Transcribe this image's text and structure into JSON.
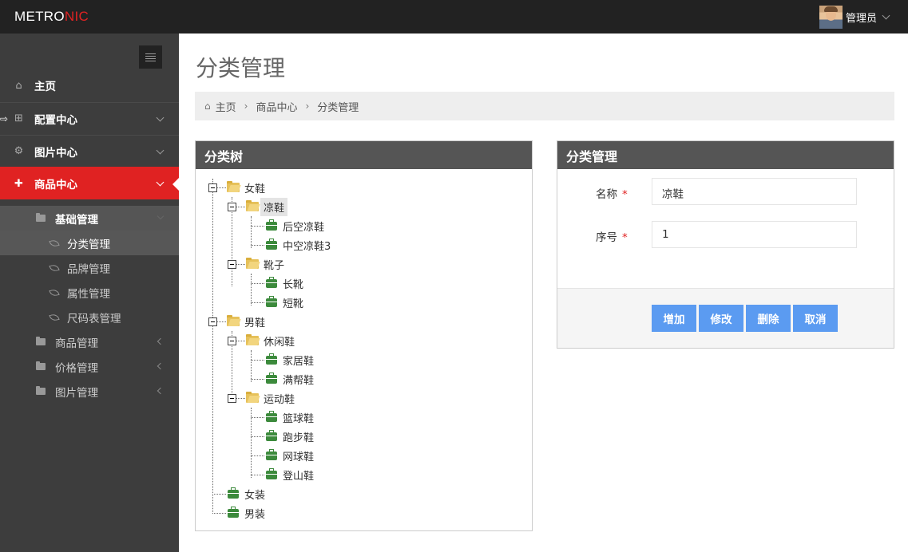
{
  "brand": {
    "prefix": "METRO",
    "accent": "NIC",
    "accent_color": "#e02222"
  },
  "user": {
    "name": "管理员"
  },
  "sidebar": {
    "items": [
      {
        "label": "主页",
        "icon": "home-icon"
      },
      {
        "label": "配置中心",
        "icon": "gift-icon"
      },
      {
        "label": "图片中心",
        "icon": "cogs-icon"
      },
      {
        "label": "商品中心",
        "icon": "puzzle-icon"
      }
    ],
    "submenu": {
      "group_label": "基础管理",
      "children": [
        "分类管理",
        "品牌管理",
        "属性管理",
        "尺码表管理"
      ],
      "others": [
        "商品管理",
        "价格管理",
        "图片管理"
      ]
    }
  },
  "page": {
    "title": "分类管理"
  },
  "breadcrumb": [
    "主页",
    "商品中心",
    "分类管理"
  ],
  "tree_panel": {
    "title": "分类树",
    "nodes": [
      "女鞋",
      "凉鞋",
      "后空凉鞋",
      "中空凉鞋3",
      "靴子",
      "长靴",
      "短靴",
      "男鞋",
      "休闲鞋",
      "家居鞋",
      "满帮鞋",
      "运动鞋",
      "篮球鞋",
      "跑步鞋",
      "网球鞋",
      "登山鞋",
      "女装",
      "男装"
    ],
    "selected": "凉鞋"
  },
  "form_panel": {
    "title": "分类管理",
    "fields": [
      {
        "label": "名称",
        "required": "*",
        "value": "凉鞋"
      },
      {
        "label": "序号",
        "required": "*",
        "value": "1"
      }
    ],
    "buttons": [
      "增加",
      "修改",
      "删除",
      "取消"
    ],
    "button_color": "#5b9bf1"
  }
}
